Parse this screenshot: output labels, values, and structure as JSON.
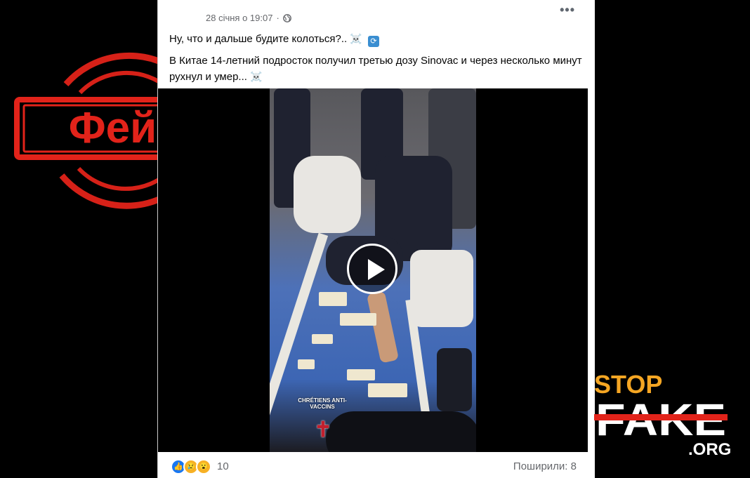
{
  "stamp": {
    "label": "Фейк",
    "color": "#e2231a"
  },
  "post": {
    "timestamp": "28 січня о 19:07",
    "separator": "·",
    "privacy_icon": "globe-icon",
    "more_icon": "more-options-icon",
    "more_label": "•••",
    "line1": "Ну, что и дальше будите колоться?..",
    "line1_emoji": "☠️",
    "line2": "В Китае 14-летний подросток получил третью дозу Sinovac и через несколько минут рухнул и умер...",
    "line2_emoji": "☠️"
  },
  "video": {
    "watermark": "CHRÉTIENS ANTI-VACCINS",
    "play_icon": "play-icon"
  },
  "footer": {
    "reaction_count": "10",
    "shares": "Поширили: 8"
  },
  "logo": {
    "stop": "STOP",
    "fake": "FAKE",
    "org": ".ORG",
    "accent": "#f5a623",
    "strike": "#e2231a"
  }
}
